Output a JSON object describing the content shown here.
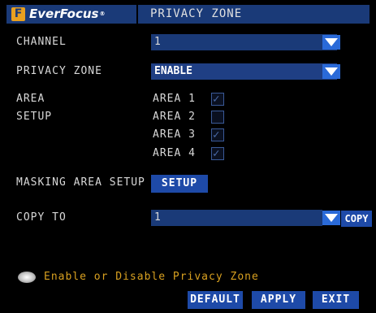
{
  "header": {
    "logo_text": "EverFocus",
    "logo_mark": "F",
    "logo_tm": "®",
    "title": "PRIVACY ZONE"
  },
  "channel": {
    "label": "CHANNEL",
    "value": "1"
  },
  "privacy_zone": {
    "label": "PRIVACY ZONE",
    "value": "ENABLE"
  },
  "area_setup": {
    "label": "AREA SETUP",
    "areas": [
      {
        "label": "AREA 1",
        "checked": true
      },
      {
        "label": "AREA 2",
        "checked": false
      },
      {
        "label": "AREA 3",
        "checked": true
      },
      {
        "label": "AREA 4",
        "checked": true
      }
    ]
  },
  "masking": {
    "label": "MASKING AREA SETUP",
    "button": "SETUP"
  },
  "copy_to": {
    "label": "COPY TO",
    "value": "1",
    "button": "COPY"
  },
  "hint": {
    "icon": "mouse-icon",
    "text": "Enable or Disable Privacy Zone"
  },
  "footer": {
    "default": "DEFAULT",
    "apply": "APPLY",
    "exit": "EXIT"
  }
}
